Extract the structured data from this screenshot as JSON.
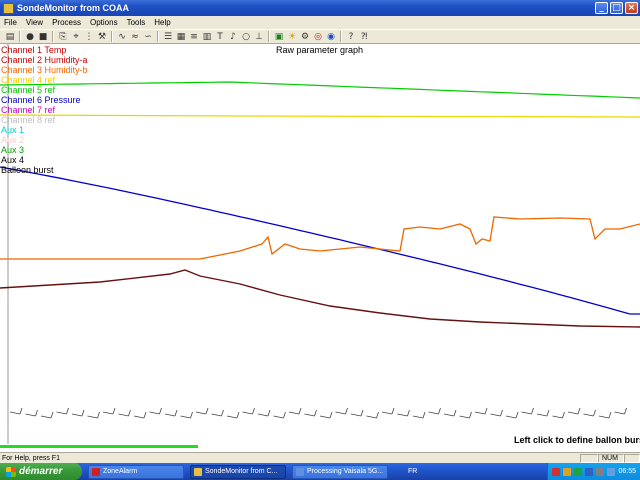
{
  "window": {
    "title": "SondeMonitor from COAA",
    "buttons": {
      "minimize": "_",
      "maximize": "□",
      "close": "×"
    }
  },
  "menu": [
    "File",
    "View",
    "Process",
    "Options",
    "Tools",
    "Help"
  ],
  "toolbar": {
    "icons": [
      "open-icon",
      "record-icon",
      "stop-icon",
      "copy-icon",
      "scope-icon",
      "filter-icon",
      "tool-icon",
      "curve-icon",
      "wave-a-icon",
      "wave-b-icon",
      "graph-list-icon",
      "graph-grid-icon",
      "graph-multi-icon",
      "graph-stack-icon",
      "text-icon",
      "sound-icon",
      "balloon-icon",
      "tower-icon",
      "map-icon",
      "sun-icon",
      "settings-icon",
      "target-icon",
      "help-icon",
      "about-icon"
    ]
  },
  "graph": {
    "title": "Raw parameter graph",
    "hint": "Left click to define ballon burst",
    "progress": 0.31,
    "legend": [
      {
        "label": "Channel 1 Temp",
        "color": "#cc0000"
      },
      {
        "label": "Channel 2 Humidity-a",
        "color": "#cc0000"
      },
      {
        "label": "Channel 3 Humidity-b",
        "color": "#ff6600"
      },
      {
        "label": "Channel 4 ref",
        "color": "#ffcc00"
      },
      {
        "label": "Channel 5 ref",
        "color": "#00cc00"
      },
      {
        "label": "Channel 6 Pressure",
        "color": "#0000cc"
      },
      {
        "label": "Channel 7 ref",
        "color": "#cc00cc"
      },
      {
        "label": "Channel 8 ref",
        "color": "#c0c0c0"
      },
      {
        "label": "Aux 1",
        "color": "#00cccc"
      },
      {
        "label": "Aux 2",
        "color": "#ffcccc"
      },
      {
        "label": "Aux 3",
        "color": "#009900"
      },
      {
        "label": "Aux 4",
        "color": "#000000"
      },
      {
        "label": "Balloon burst",
        "color": "#000000"
      }
    ]
  },
  "statusbar": {
    "help": "For Help, press F1",
    "num": "NUM"
  },
  "taskbar": {
    "start": "démarrer",
    "tasks": [
      {
        "label": "ZoneAlarm",
        "color": "#d02020",
        "active": false
      },
      {
        "label": "SondeMonitor from C...",
        "color": "#e8c040",
        "active": true
      },
      {
        "label": "Processing Vaisala 5G...",
        "color": "#6090e0",
        "active": false
      }
    ],
    "lang": "FR",
    "clock": "06:55"
  }
}
